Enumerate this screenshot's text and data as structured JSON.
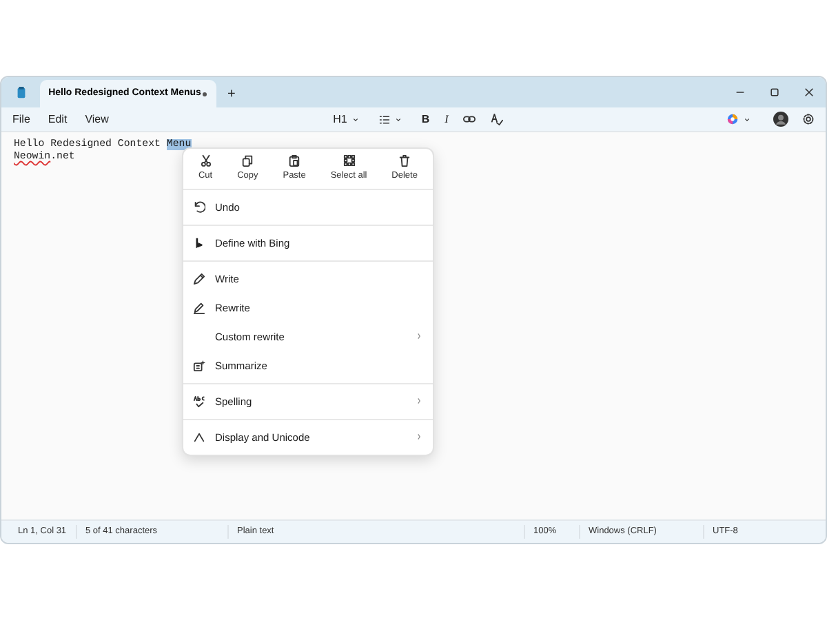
{
  "tab": {
    "title": "Hello Redesigned Context Menus",
    "modified": true,
    "selected": true
  },
  "new_tab": "+",
  "menu_bar": [
    "File",
    "Edit",
    "View"
  ],
  "format_toolbar": {
    "heading": "H1",
    "bold": "B",
    "italic": "I"
  },
  "document": {
    "lines": [
      {
        "before": "Hello Redesigned Context ",
        "selection": "Menu"
      },
      {
        "before": "Neowin",
        "misspelled": true,
        "after": ".net"
      }
    ]
  },
  "quick_actions": [
    "Cut",
    "Copy",
    "Paste",
    "Select all",
    "Delete"
  ],
  "context_menu": [
    [
      {
        "label": "Undo",
        "submenu": false
      }
    ],
    [
      {
        "label": "Define with Bing",
        "submenu": false
      }
    ],
    [
      {
        "label": "Write",
        "submenu": false
      },
      {
        "label": "Rewrite",
        "submenu": false
      },
      {
        "label": "Custom rewrite",
        "submenu": true
      },
      {
        "label": "Summarize",
        "submenu": false
      }
    ],
    [
      {
        "label": "Spelling",
        "submenu": true
      }
    ],
    [
      {
        "label": "Display and Unicode",
        "submenu": true
      }
    ]
  ],
  "status_bar": [
    "Ln 1, Col 31",
    "5 of 41 characters",
    "Plain text",
    "100%",
    "Windows (CRLF)",
    "UTF-8"
  ]
}
